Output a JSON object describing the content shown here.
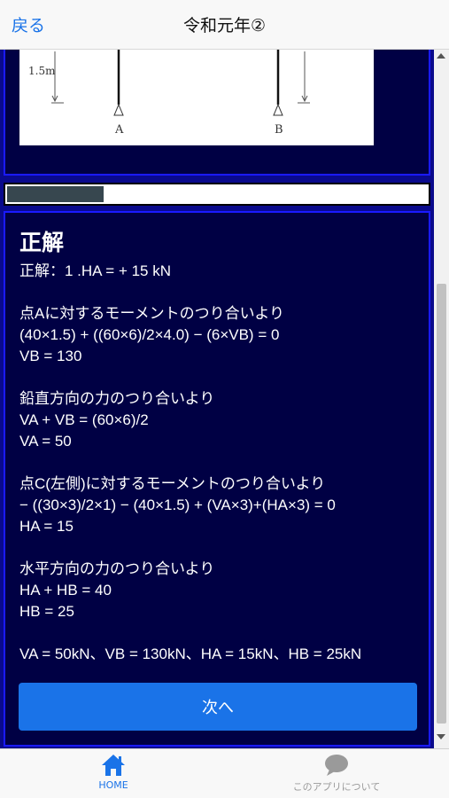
{
  "header": {
    "back_label": "戻る",
    "title": "令和元年②"
  },
  "figure": {
    "height_label": "1.5m",
    "support_a": "A",
    "support_b": "B"
  },
  "progress": {
    "fraction": 0.23
  },
  "answer": {
    "heading": "正解",
    "text": "正解：1 .HA = + 15 kN\n\n点Aに対するモーメントのつり合いより\n(40×1.5) + ((60×6)/2×4.0) − (6×VB) = 0\nVB = 130\n\n鉛直方向の力のつり合いより\nVA + VB = (60×6)/2\nVA = 50\n\n点C(左側)に対するモーメントのつり合いより\n− ((30×3)/2×1) − (40×1.5) + (VA×3)+(HA×3) = 0\nHA = 15\n\n水平方向の力のつり合いより\nHA + HB = 40\nHB = 25\n\nVA = 50kN、VB = 130kN、HA = 15kN、HB = 25kN",
    "next_label": "次へ"
  },
  "tabs": [
    {
      "label": "HOME",
      "icon": "home-icon",
      "color": "#1a73e8"
    },
    {
      "label": "このアプリについて",
      "icon": "chat-bubble-icon",
      "color": "#9a9a9a"
    }
  ],
  "colors": {
    "accent": "#1a73e8",
    "panel": "#000044",
    "border": "#1a1aff",
    "background": "#0a0a8c"
  }
}
